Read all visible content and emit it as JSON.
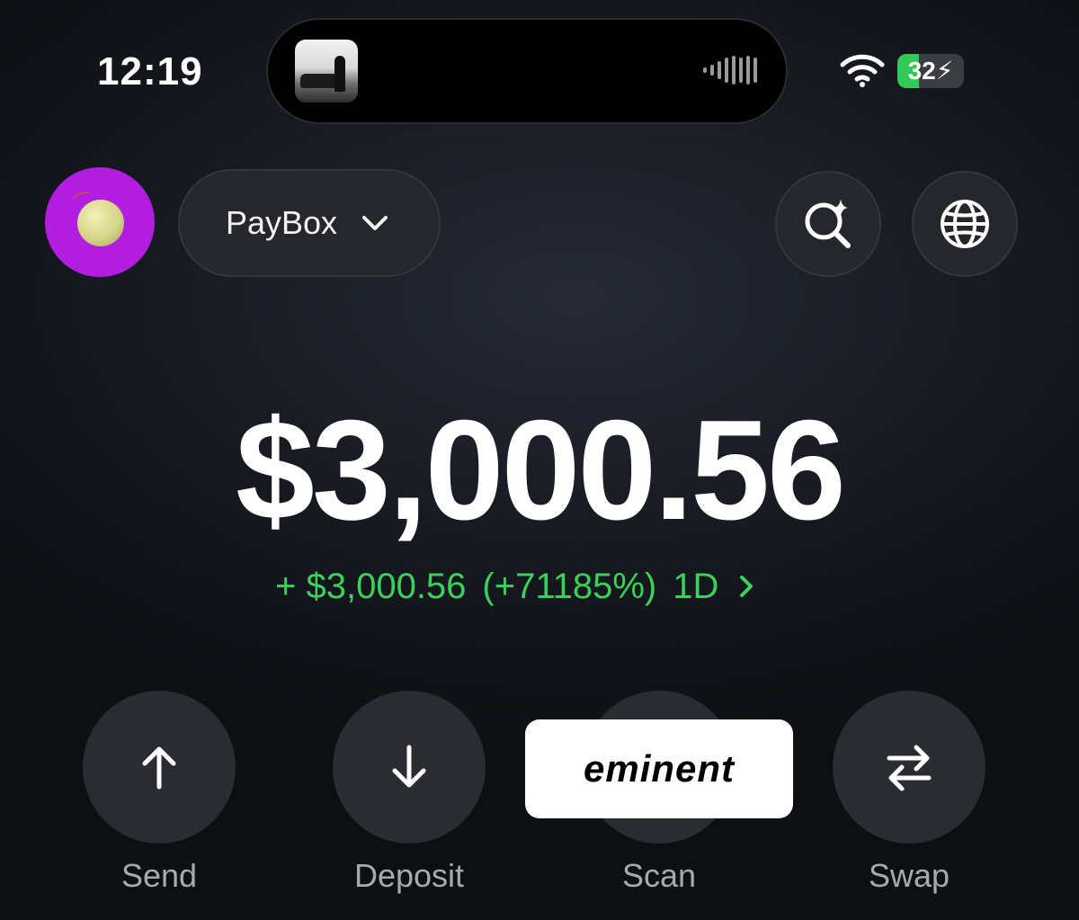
{
  "status_bar": {
    "time": "12:19",
    "battery_level": "32",
    "battery_percent": 32,
    "battery_color": "#34c759"
  },
  "header": {
    "avatar_icon": "melon-avatar-icon",
    "avatar_color": "#b21de0",
    "wallet_name": "PayBox",
    "dropdown_icon": "chevron-down-icon",
    "search_icon": "sparkle-search-icon",
    "globe_icon": "globe-icon"
  },
  "balance": {
    "amount": "$3,000.56",
    "change_amount": "+ $3,000.56",
    "change_percent": "(+71185%)",
    "period": "1D",
    "period_icon": "chevron-right-icon",
    "change_color": "#3ccf5a"
  },
  "actions": [
    {
      "label": "Send",
      "icon": "arrow-up-icon"
    },
    {
      "label": "Deposit",
      "icon": "arrow-down-icon"
    },
    {
      "label": "Scan",
      "icon": "scan-icon"
    },
    {
      "label": "Swap",
      "icon": "swap-arrows-icon"
    }
  ],
  "overlay": {
    "sticker_text": "eminent"
  }
}
